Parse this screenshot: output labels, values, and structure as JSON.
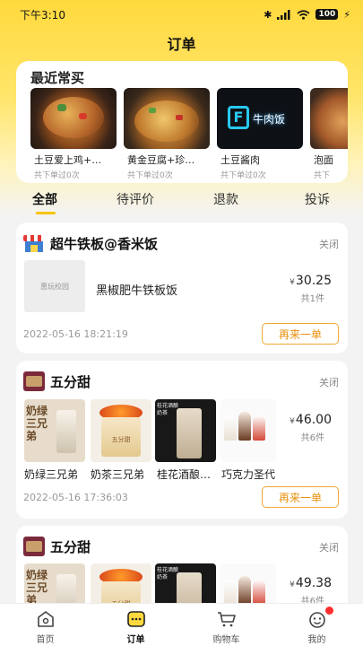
{
  "status_bar": {
    "time": "下午3:10",
    "battery": "100"
  },
  "header": {
    "title": "订单"
  },
  "recent": {
    "title": "最近常买",
    "items": [
      {
        "name": "土豆爱上鸡+…",
        "count": "共下单过0次"
      },
      {
        "name": "黄金豆腐+珍…",
        "count": "共下单过0次"
      },
      {
        "name": "土豆酱肉",
        "count": "共下单过0次"
      },
      {
        "name": "泡面",
        "count": "共下"
      }
    ],
    "sign_text": "牛肉饭"
  },
  "tabs": [
    {
      "label": "全部"
    },
    {
      "label": "待评价"
    },
    {
      "label": "退款"
    },
    {
      "label": "投诉"
    }
  ],
  "orders": [
    {
      "shop": "超牛铁板@香米饭",
      "status": "关闭",
      "placeholder_text": "惠玩校园",
      "item_name": "黑椒肥牛铁板饭",
      "currency": "¥",
      "price": "30.25",
      "qty": "共1件",
      "time": "2022-05-16 18:21:19",
      "action": "再来一单"
    },
    {
      "shop": "五分甜",
      "status": "关闭",
      "items": [
        "奶绿三兄弟",
        "奶茶三兄弟",
        "桂花酒酿…",
        "巧克力圣代"
      ],
      "thumb_texts": [
        "奶绿三兄弟",
        "五分甜",
        "桂花酒酿奶茶",
        ""
      ],
      "currency": "¥",
      "price": "46.00",
      "qty": "共6件",
      "time": "2022-05-16 17:36:03",
      "action": "再来一单"
    },
    {
      "shop": "五分甜",
      "status": "关闭",
      "thumb_texts": [
        "奶绿三兄弟",
        "五分甜",
        "桂花酒酿奶茶",
        ""
      ],
      "currency": "¥",
      "price": "49.38",
      "qty": "共6件"
    }
  ],
  "bottom_nav": [
    {
      "label": "首页",
      "icon": "home-icon"
    },
    {
      "label": "订单",
      "icon": "orders-icon"
    },
    {
      "label": "购物车",
      "icon": "cart-icon"
    },
    {
      "label": "我的",
      "icon": "profile-icon"
    }
  ],
  "colors": {
    "brand_yellow": "#ffd93d",
    "accent_orange": "#e8900c",
    "notification_red": "#ff2d2d"
  }
}
